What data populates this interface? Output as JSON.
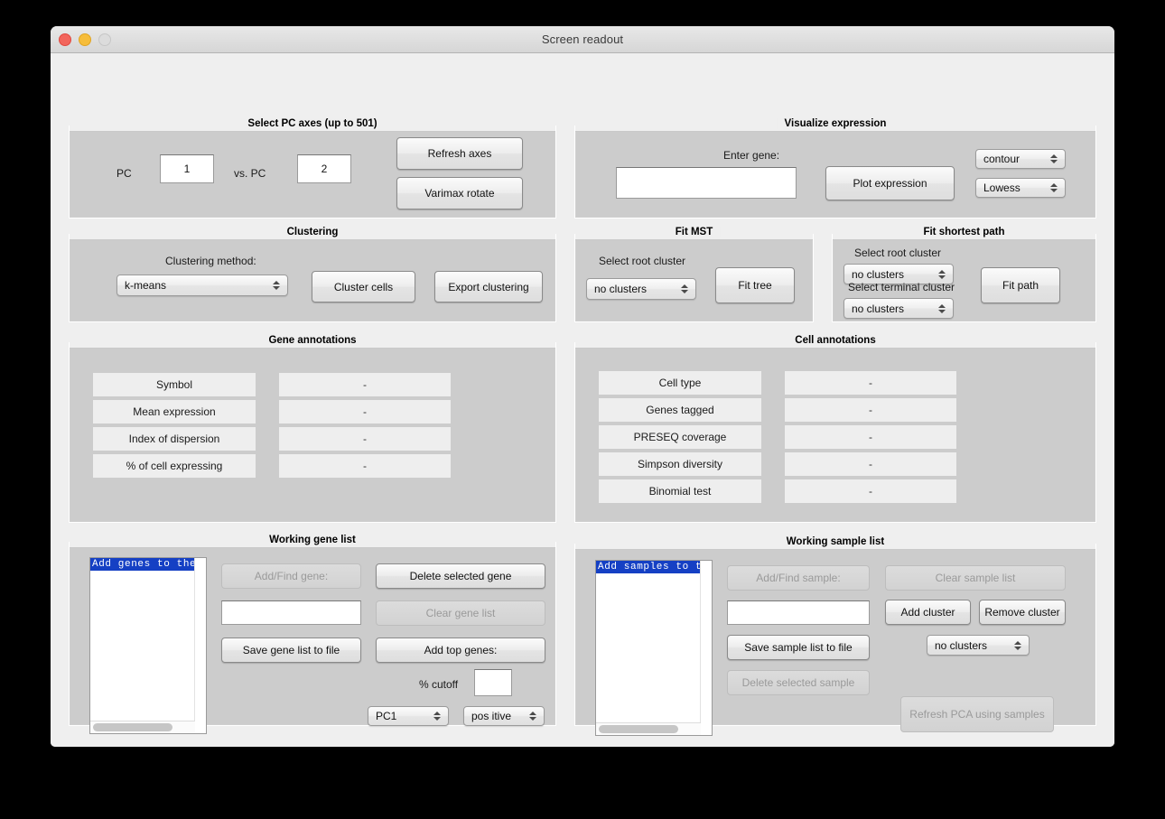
{
  "window": {
    "title": "Screen readout",
    "controls": [
      "close-button",
      "minimize-button",
      "zoom-button"
    ]
  },
  "panels": {
    "pc_axes": {
      "title": "Select PC axes (up to 501)",
      "label_pc": "PC",
      "label_vs_pc": "vs. PC",
      "pc_x_value": "1",
      "pc_y_value": "2",
      "refresh_axes": "Refresh axes",
      "varimax_rotate": "Varimax rotate"
    },
    "visualize_expression": {
      "title": "Visualize expression",
      "enter_gene_label": "Enter gene:",
      "gene_value": "",
      "plot_expression": "Plot expression",
      "plot_type": "contour",
      "smoothing": "Lowess"
    },
    "clustering": {
      "title": "Clustering",
      "method_label": "Clustering method:",
      "method_value": "k-means",
      "cluster_cells": "Cluster cells",
      "export_clustering": "Export clustering"
    },
    "fit_mst": {
      "title": "Fit MST",
      "root_label": "Select root cluster",
      "root_value": "no clusters",
      "fit_tree": "Fit tree"
    },
    "fit_shortest_path": {
      "title": "Fit shortest path",
      "root_label": "Select root cluster",
      "root_value": "no clusters",
      "terminal_label": "Select terminal cluster",
      "terminal_value": "no clusters",
      "fit_path": "Fit path"
    },
    "gene_annotations": {
      "title": "Gene annotations",
      "rows": [
        {
          "name": "Symbol",
          "value": "-"
        },
        {
          "name": "Mean expression",
          "value": "-"
        },
        {
          "name": "Index of dispersion",
          "value": "-"
        },
        {
          "name": "% of cell expressing",
          "value": "-"
        }
      ]
    },
    "cell_annotations": {
      "title": "Cell annotations",
      "rows": [
        {
          "name": "Cell type",
          "value": "-"
        },
        {
          "name": "Genes tagged",
          "value": "-"
        },
        {
          "name": "PRESEQ coverage",
          "value": "-"
        },
        {
          "name": "Simpson diversity",
          "value": "-"
        },
        {
          "name": "Binomial test",
          "value": "-"
        }
      ]
    },
    "working_gene_list": {
      "title": "Working gene list",
      "list_first_row": "Add genes to the li",
      "add_find_gene": "Add/Find gene:",
      "gene_input_value": "",
      "save_gene_list": "Save gene list to file",
      "delete_selected_gene": "Delete selected gene",
      "clear_gene_list": "Clear gene list",
      "add_top_genes": "Add top genes:",
      "cutoff_label": "% cutoff",
      "cutoff_value": "",
      "pc_select": "PC1",
      "sign_select": "pos itive"
    },
    "working_sample_list": {
      "title": "Working sample list",
      "list_first_row": "Add samples to the",
      "add_find_sample": "Add/Find sample:",
      "sample_input_value": "",
      "save_sample_list": "Save sample list to file",
      "delete_selected_sample": "Delete selected sample",
      "clear_sample_list": "Clear sample list",
      "add_cluster": "Add cluster",
      "remove_cluster": "Remove cluster",
      "cluster_select": "no clusters",
      "refresh_pca": "Refresh PCA using samples"
    }
  },
  "colors": {
    "window_background": "#efefef",
    "panel_background": "#cccccc",
    "selection_blue": "#1540c4",
    "close_button": "#f2655c",
    "minimize_button": "#f6bd3b",
    "zoom_button": "#dcdcdc"
  }
}
